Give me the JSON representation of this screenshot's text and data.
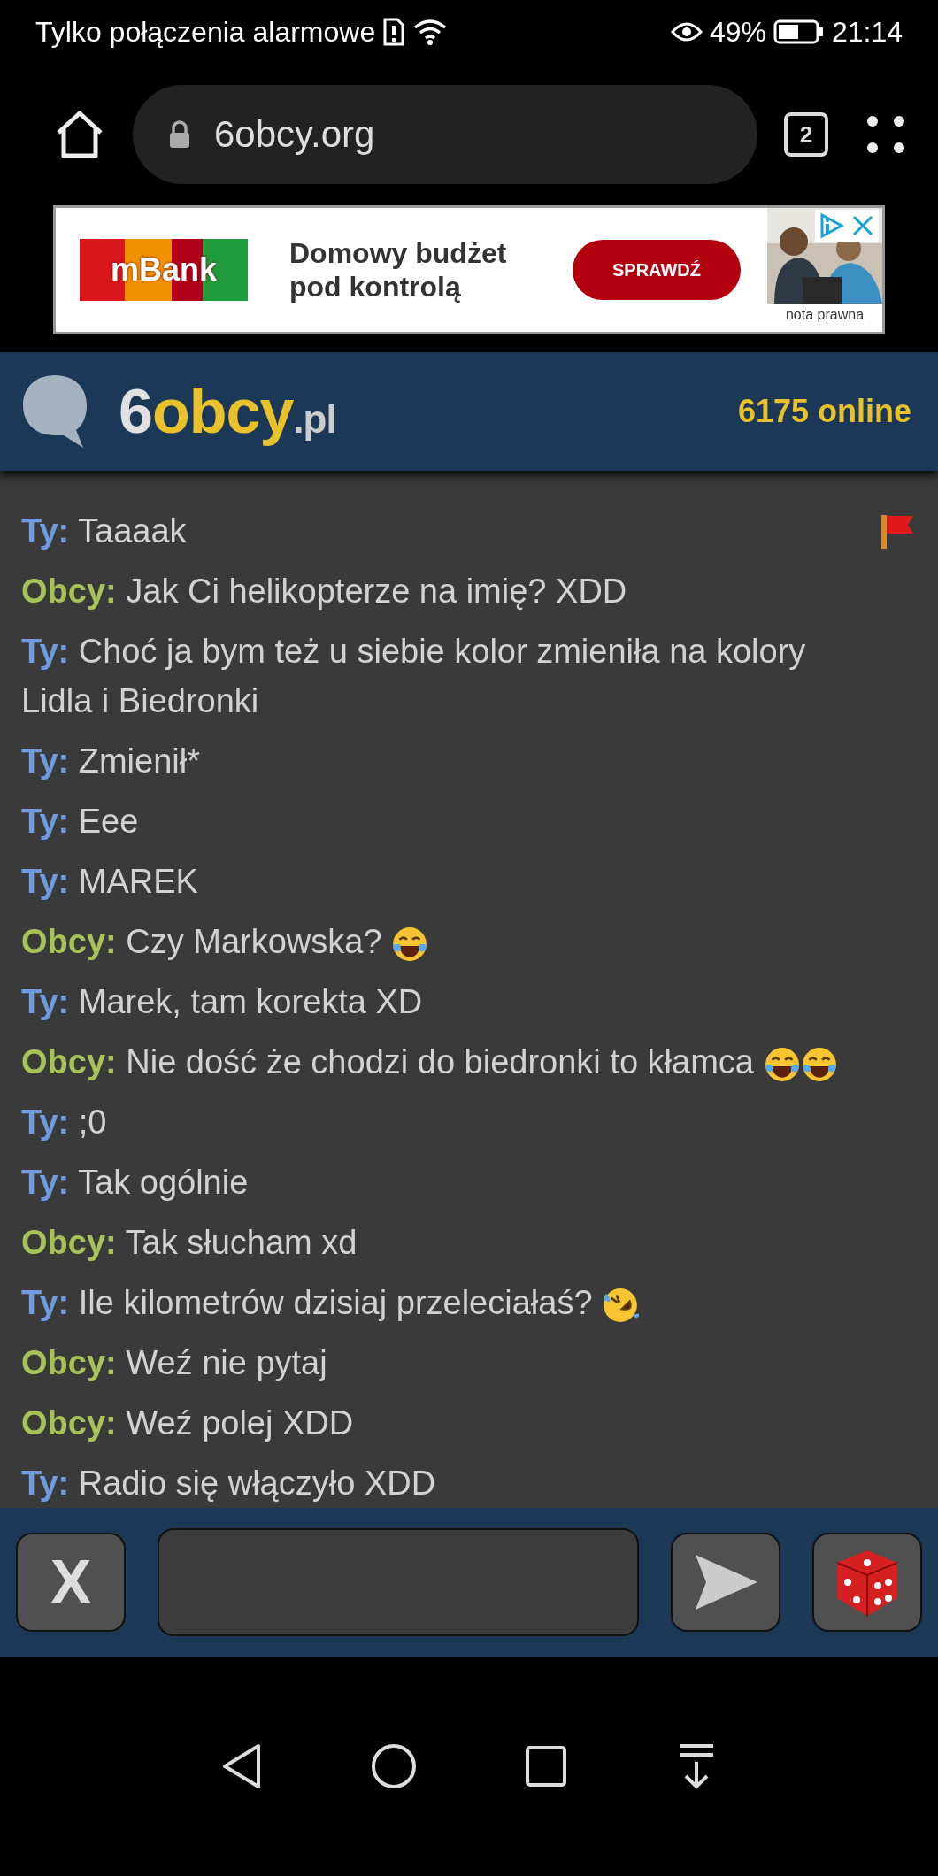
{
  "status_bar": {
    "carrier": "Tylko połączenia alarmowe",
    "battery_percent": "49%",
    "time": "21:14"
  },
  "browser": {
    "url": "6obcy.org",
    "tab_count": "2"
  },
  "ad": {
    "brand": "mBank",
    "headline": "Domowy budżet pod kontrolą",
    "cta": "SPRAWDŹ",
    "legal": "nota prawna"
  },
  "header": {
    "logo": [
      "6",
      "obcy",
      ".pl"
    ],
    "online": "6175 online"
  },
  "messages": [
    {
      "kind": "you",
      "author": "Ty:",
      "text": "Taaaak",
      "report": true
    },
    {
      "kind": "stranger",
      "author": "Obcy:",
      "text": "Jak Ci helikopterze na imię? XDD",
      "report": false
    },
    {
      "kind": "you",
      "author": "Ty:",
      "text": "Choć ja bym też u siebie kolor zmieniła na kolory Lidla i Biedronki",
      "report": false
    },
    {
      "kind": "you",
      "author": "Ty:",
      "text": "Zmienił*",
      "report": false
    },
    {
      "kind": "you",
      "author": "Ty:",
      "text": "Eee",
      "report": false
    },
    {
      "kind": "you",
      "author": "Ty:",
      "text": "MAREK",
      "report": false
    },
    {
      "kind": "stranger",
      "author": "Obcy:",
      "text": "Czy Markowska?",
      "report": false,
      "emojis": [
        {
          "kind": "tears"
        }
      ]
    },
    {
      "kind": "you",
      "author": "Ty:",
      "text": "Marek, tam korekta XD",
      "report": false
    },
    {
      "kind": "stranger",
      "author": "Obcy:",
      "text": "Nie dość że chodzi do biedronki to kłamca",
      "report": false,
      "emojis": [
        {
          "kind": "tears"
        },
        {
          "kind": "tears"
        }
      ]
    },
    {
      "kind": "you",
      "author": "Ty:",
      "text": ";0",
      "report": false
    },
    {
      "kind": "you",
      "author": "Ty:",
      "text": "Tak ogólnie",
      "report": false
    },
    {
      "kind": "stranger",
      "author": "Obcy:",
      "text": "Tak słucham xd",
      "report": false
    },
    {
      "kind": "you",
      "author": "Ty:",
      "text": "Ile kilometrów dzisiaj przeleciałaś?",
      "report": false,
      "emojis": [
        {
          "kind": "rofl"
        }
      ]
    },
    {
      "kind": "stranger",
      "author": "Obcy:",
      "text": "Weź nie pytaj",
      "report": false
    },
    {
      "kind": "stranger",
      "author": "Obcy:",
      "text": "Weź polej XDD",
      "report": false
    },
    {
      "kind": "you",
      "author": "Ty:",
      "text": "Radio się włączyło XDD",
      "report": false
    }
  ],
  "composer": {
    "end_label": "X"
  }
}
